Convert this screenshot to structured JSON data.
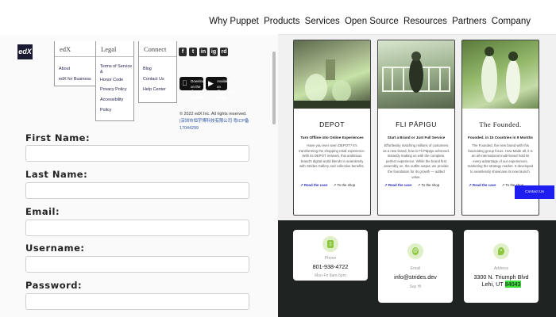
{
  "nav": {
    "links": [
      "Why Puppet",
      "Products",
      "Services",
      "Open Source",
      "Resources",
      "Partners",
      "Company"
    ]
  },
  "footer": {
    "logo": "edX",
    "edx": {
      "title": "edX",
      "links": [
        "About",
        "edX for Business"
      ]
    },
    "legal": {
      "title": "Legal",
      "links": [
        "Terms of Service &",
        "Honor Code",
        "Privacy Policy",
        "Accessibility Policy"
      ]
    },
    "connect": {
      "title": "Connect",
      "links": [
        "Blog",
        "Contact Us",
        "Help Center"
      ]
    },
    "social": [
      "f",
      "t",
      "in",
      "ig",
      "rd"
    ],
    "appstore": {
      "small": "Download on the",
      "big": "App Store"
    },
    "googleplay": {
      "small": "Available on",
      "big": "Google Play"
    },
    "copyright": "© 2022 edX Inc. All rights reserved.",
    "icp": "|深圳市恒宇博科技有限公司 粤ICP备17044299"
  },
  "form": {
    "first_name": "First Name:",
    "last_name": "Last Name:",
    "email": "Email:",
    "username": "Username:",
    "password": "Password:"
  },
  "cards": [
    {
      "title": "DEPOT",
      "subtitle": "Turn Offline into Online Experiences",
      "desc": "Have you ever seen DEPOT? It's transforming the shopping retail experience. With its DEPOT network, this ambitious brand's digital world blends in seamlessly with Strides Gallery and collective benefits.",
      "link1": "↗ Read the case",
      "link2": "↗ To the shop"
    },
    {
      "title": "FLI PĀPIGU",
      "subtitle": "Start a Brand or Just Full Service",
      "desc": "Effortlessly matching millions of customers as a new brand, how is Fli Pāpigu achieved. Instantly making us with the complete, perfect experience. While the brand first assembly on, the outfits output, we provide the foundation for its growth — added value.",
      "link1": "↗ Read the case",
      "link2": "↗ To the shop"
    },
    {
      "title": "The Founded.",
      "subtitle": "Founded. in 15 Countries in 9 Months",
      "desc": "The Founded, the new brand with this fascinating group focus. How Made all, it is an all-international multi-brand hold its every advantage of our experiences, marketing the strategy market. It developed to seamlessly showcase its new launch.",
      "link1": "↗ Read the case",
      "link2": "↗ To the shop"
    }
  ],
  "floating_button": "Contact Us",
  "contact": [
    {
      "label": "Phone",
      "value": "801-938-4722",
      "small": "Mon-Fri 8am-5pm"
    },
    {
      "label": "Email",
      "value": "info@strides.dev",
      "small": "Say Hi"
    },
    {
      "label": "Address",
      "value_line1": "3300 N. Triumph Blvd",
      "value_line2_pre": "Lehi, UT ",
      "value_line2_hl": "84043"
    }
  ],
  "colors": {
    "accent_blue": "#1e1ef0",
    "contact_bg": "#1f2321",
    "icon_green": "#8dc63f",
    "highlight": "#3ddc3d"
  }
}
